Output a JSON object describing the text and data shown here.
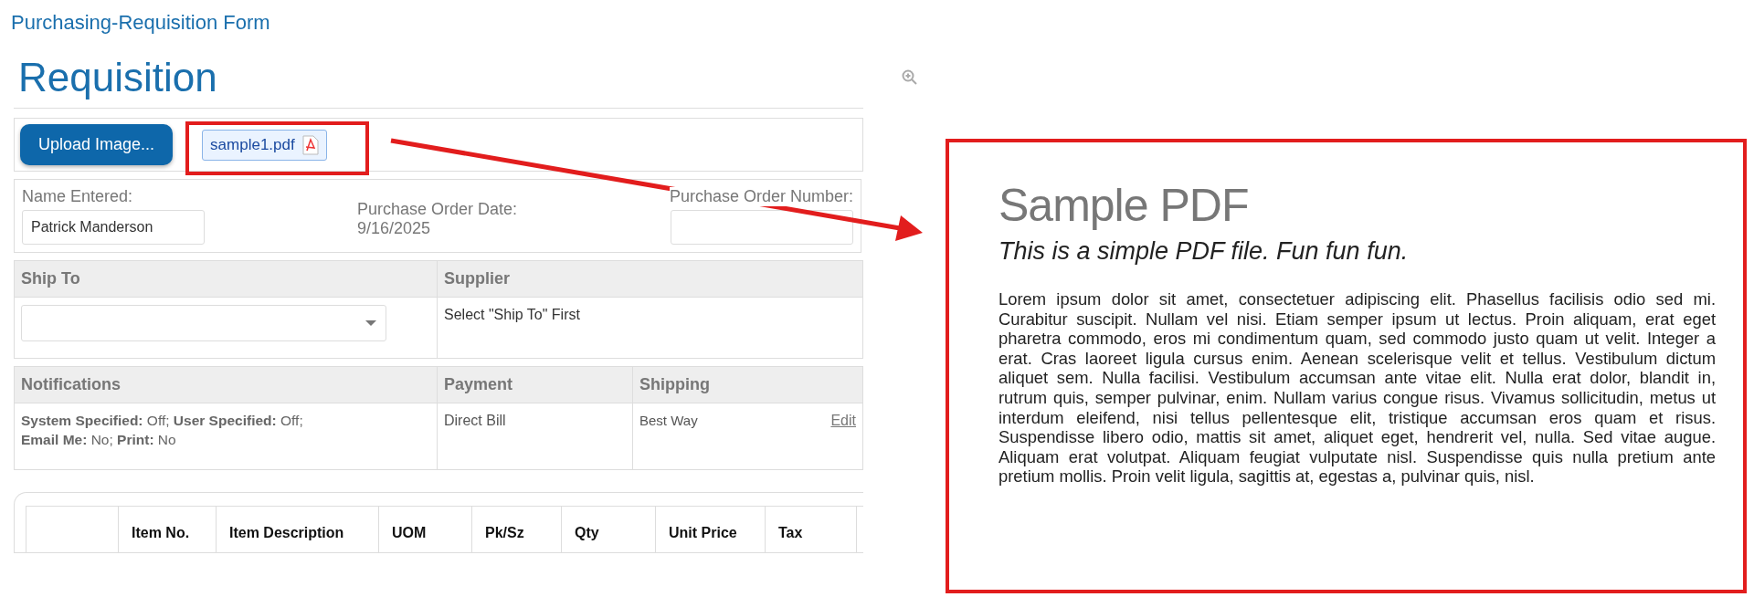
{
  "page_title": "Purchasing-Requisition Form",
  "form": {
    "heading": "Requisition",
    "upload_button": "Upload Image...",
    "attachment": {
      "name": "sample1.pdf"
    },
    "name_entered": {
      "label": "Name Entered:",
      "value": "Patrick Manderson"
    },
    "po_date": {
      "label": "Purchase Order Date:",
      "value": "9/16/2025"
    },
    "po_number": {
      "label": "Purchase Order Number:"
    },
    "ship_to": {
      "label": "Ship To"
    },
    "supplier": {
      "label": "Supplier",
      "value": "Select \"Ship To\" First"
    },
    "notifications": {
      "label": "Notifications",
      "value": "**System Specified:** Off; **User Specified:** Off; **Email Me:** No; **Print:** No"
    },
    "payment": {
      "label": "Payment",
      "value": "Direct Bill"
    },
    "shipping": {
      "label": "Shipping",
      "value": "Best Way",
      "link": "Edit"
    },
    "items_table": {
      "columns": [
        "Item No.",
        "Item Description",
        "UOM",
        "Pk/Sz",
        "Qty",
        "Unit Price",
        "Tax"
      ]
    }
  },
  "preview": {
    "title": "Sample PDF",
    "subtitle": "This is a simple PDF file. Fun fun fun.",
    "body": "Lorem ipsum dolor sit amet, consectetuer adipiscing elit. Phasellus facilisis odio sed mi. Curabitur suscipit. Nullam vel nisi. Etiam semper ipsum ut lectus. Proin aliquam, erat eget pharetra commodo, eros mi condimentum quam, sed commodo justo quam ut velit. Integer a erat. Cras laoreet ligula cursus enim. Aenean scelerisque velit et tellus. Vestibulum dictum aliquet sem. Nulla facilisi. Vestibulum accumsan ante vitae elit. Nulla erat dolor, blandit in, rutrum quis, semper pulvinar, enim. Nullam varius congue risus. Vivamus sollicitudin, metus ut interdum eleifend, nisi tellus pellentesque elit, tristique accumsan eros quam et risus. Suspendisse libero odio, mattis sit amet, aliquet eget, hendrerit vel, nulla. Sed vitae augue. Aliquam erat volutpat. Aliquam feugiat vulputate nisl. Suspendisse quis nulla pretium ante pretium mollis. Proin velit ligula, sagittis at, egestas a, pulvinar quis, nisl."
  }
}
